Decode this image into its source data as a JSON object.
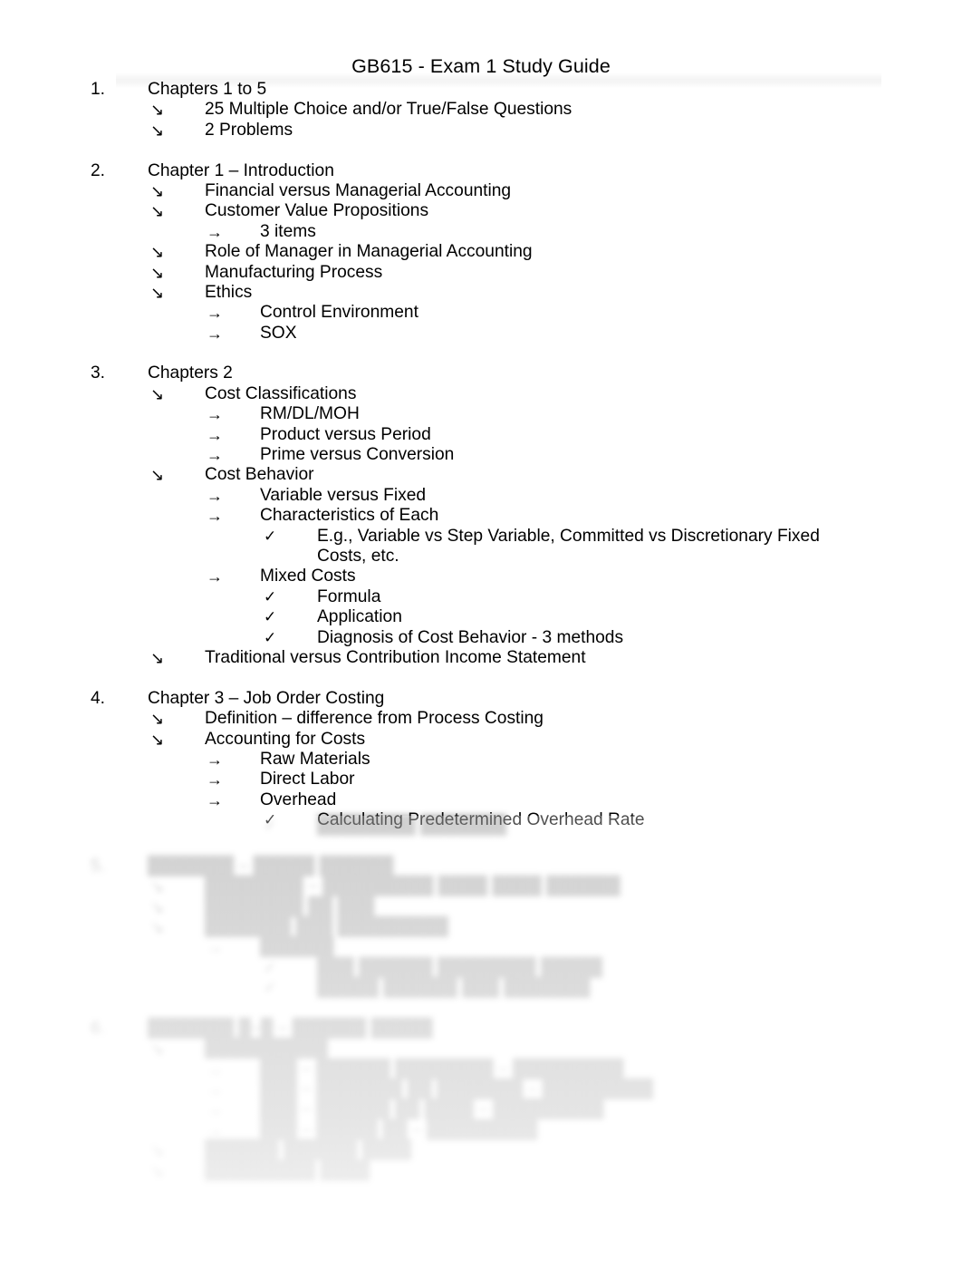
{
  "document": {
    "title": "GB615 - Exam 1 Study Guide",
    "markers": {
      "level1": "↘",
      "level2": "→",
      "level3": "✓"
    },
    "sections": [
      {
        "number": "1.",
        "heading": "Chapters 1 to 5",
        "items": [
          {
            "level": 1,
            "text": "25 Multiple Choice and/or True/False Questions"
          },
          {
            "level": 1,
            "text": "2 Problems"
          }
        ]
      },
      {
        "number": "2.",
        "heading": "Chapter 1 – Introduction",
        "items": [
          {
            "level": 1,
            "text": "Financial versus Managerial Accounting"
          },
          {
            "level": 1,
            "text": "Customer Value Propositions"
          },
          {
            "level": 2,
            "text": "3 items"
          },
          {
            "level": 1,
            "text": "Role of Manager in Managerial Accounting"
          },
          {
            "level": 1,
            "text": "Manufacturing Process"
          },
          {
            "level": 1,
            "text": "Ethics"
          },
          {
            "level": 2,
            "text": "Control Environment"
          },
          {
            "level": 2,
            "text": "SOX"
          }
        ]
      },
      {
        "number": "3.",
        "heading": "Chapters 2",
        "items": [
          {
            "level": 1,
            "text": "Cost Classifications"
          },
          {
            "level": 2,
            "text": "RM/DL/MOH"
          },
          {
            "level": 2,
            "text": "Product versus Period"
          },
          {
            "level": 2,
            "text": "Prime versus Conversion"
          },
          {
            "level": 1,
            "text": "Cost Behavior"
          },
          {
            "level": 2,
            "text": "Variable versus Fixed"
          },
          {
            "level": 2,
            "text": "Characteristics of Each"
          },
          {
            "level": 3,
            "text": "E.g., Variable vs Step Variable, Committed vs Discretionary Fixed Costs, etc.",
            "wrap": true
          },
          {
            "level": 2,
            "text": "Mixed Costs"
          },
          {
            "level": 3,
            "text": "Formula"
          },
          {
            "level": 3,
            "text": "Application"
          },
          {
            "level": 3,
            "text": "Diagnosis of Cost Behavior - 3 methods"
          },
          {
            "level": 1,
            "text": "Traditional versus Contribution Income Statement"
          }
        ]
      },
      {
        "number": "4.",
        "heading": "Chapter 3 – Job Order Costing",
        "items": [
          {
            "level": 1,
            "text": "Definition – difference from Process Costing"
          },
          {
            "level": 1,
            "text": "Accounting for Costs"
          },
          {
            "level": 2,
            "text": "Raw Materials"
          },
          {
            "level": 2,
            "text": "Direct Labor"
          },
          {
            "level": 2,
            "text": "Overhead"
          },
          {
            "level": 3,
            "text": "Calculating Predetermined Overhead Rate"
          }
        ]
      }
    ],
    "obscured_preview_note": "Remaining outline content below is blurred and unreadable in the source image.",
    "obscured_sections": [
      {
        "number": "5.",
        "heading": "███████ – █████ ██████",
        "items": [
          {
            "level": 1,
            "text": "████████ – █████████ ████ ████ ██████"
          },
          {
            "level": 1,
            "text": "████████ ██ ███"
          },
          {
            "level": 1,
            "text": "███████ ███ █████████"
          },
          {
            "level": 2,
            "text": "██████"
          },
          {
            "level": 3,
            "text": "███ ██████ ████████ █████"
          },
          {
            "level": 3,
            "text": "█████ ██████ ███ ███████"
          }
        ]
      },
      {
        "number": "6.",
        "heading": "███████ █–█ – ██████ █████",
        "items": [
          {
            "level": 1,
            "text": "██████████"
          },
          {
            "level": 2,
            "text": "███ – ██████ ████████ – █████████"
          },
          {
            "level": 2,
            "text": "███ – ███████ ██ ███████ – █████████"
          },
          {
            "level": 2,
            "text": "███ – ██████ ██ ████ – █████████"
          },
          {
            "level": 2,
            "text": "███ – █████ ██ – █████████"
          },
          {
            "level": 1,
            "text": "██████ ██████ ████"
          },
          {
            "level": 1,
            "text": "█████████ ████"
          }
        ]
      }
    ]
  }
}
